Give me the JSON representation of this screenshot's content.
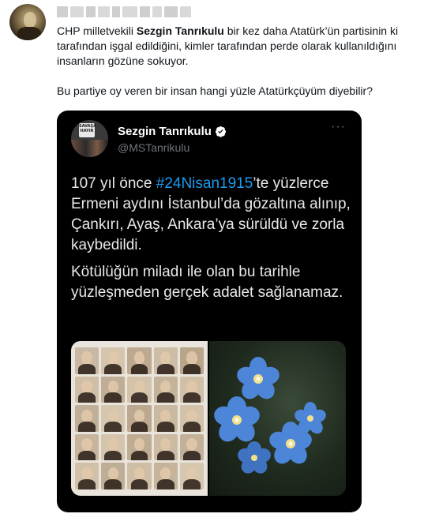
{
  "tweet": {
    "author_blurred": "",
    "text_part1": "CHP milletvekili ",
    "text_bold": "Sezgin Tanrıkulu",
    "text_part2": " bir kez daha Atatürk’ün partisinin ki tarafından işgal edildiğini, kimler tarafından perde olarak kullanıldığını insanların gözüne sokuyor.",
    "text_paragraph2": "Bu partiye oy veren bir insan hangi yüzle Atatürkçüyüm diyebilir?"
  },
  "quoted_tweet": {
    "name": "Sezgin Tanrıkulu",
    "handle": "@MSTanrikulu",
    "avatar_sign_text": "SAVAŞA HAYIR",
    "more_label": "···",
    "text_p1_before": "107 yıl önce ",
    "text_p1_hashtag": "#24Nisan1915",
    "text_p1_after": "’te yüzlerce Ermeni aydını İstanbul’da gözaltına alınıp, Çankırı, Ayaş, Ankara’ya sürüldü ve zorla kaybedildi.",
    "text_p2": "Kötülüğün miladı ile olan bu tarihle yüzleşmeden gerçek adalet sağlanamaz."
  },
  "colors": {
    "link": "#1d9bf0",
    "card_bg": "#000000",
    "verified": "#ffffff",
    "muted": "#71767b"
  },
  "icons": {
    "verified": "verified-badge-icon",
    "more": "more-options-icon"
  }
}
